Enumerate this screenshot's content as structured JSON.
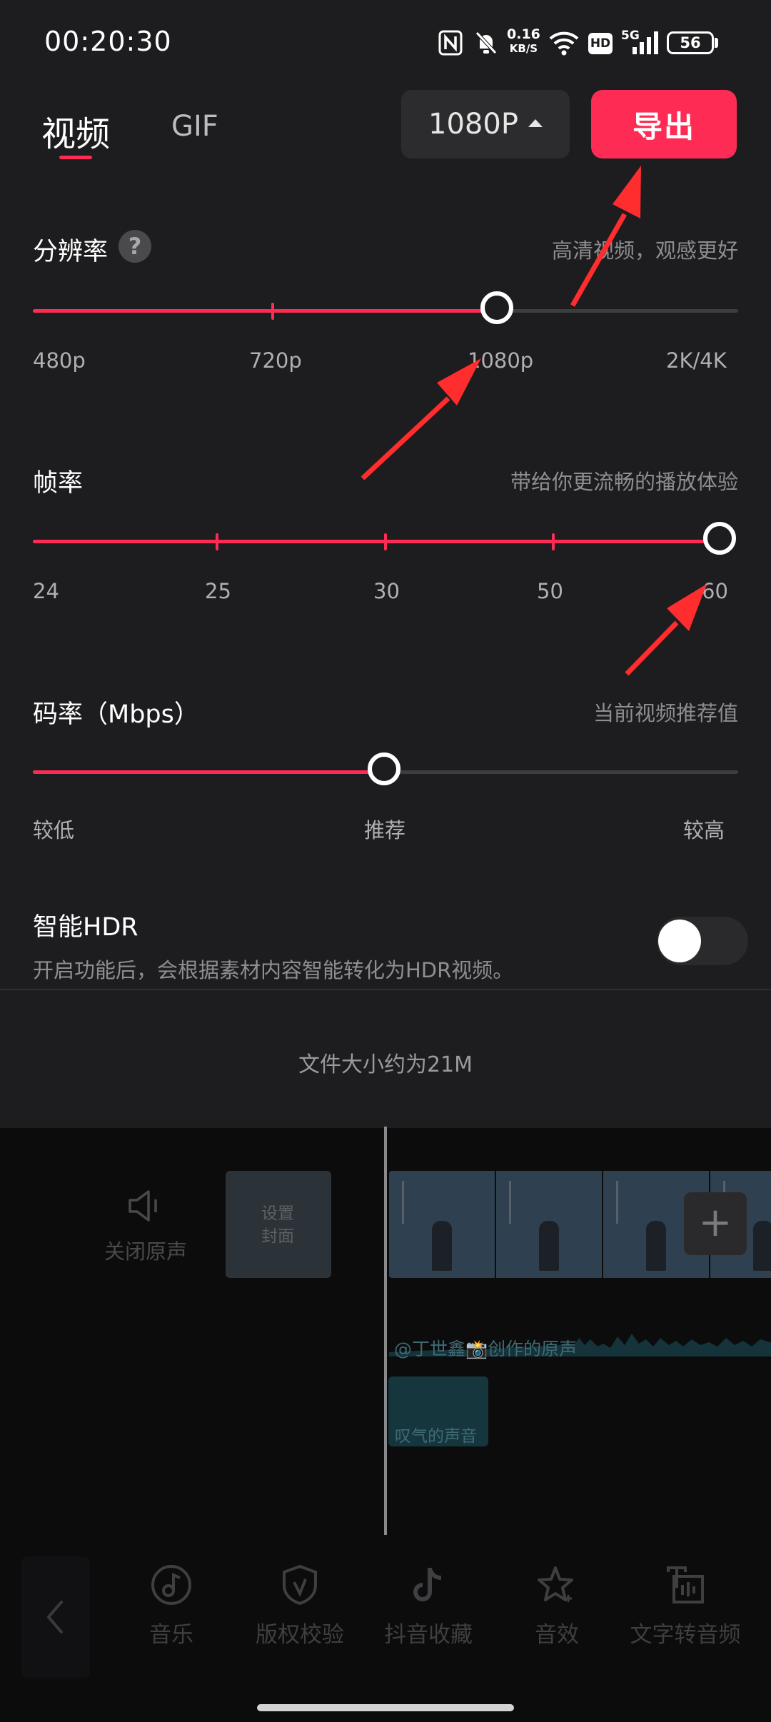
{
  "status_bar": {
    "time": "00:20:30",
    "net_speed_value": "0.16",
    "net_speed_unit": "KB/S",
    "hd_badge": "HD",
    "network_type": "5G",
    "battery": "56",
    "icons": [
      "nfc-icon",
      "mute-bell-icon",
      "wifi-icon",
      "hd-icon",
      "signal-5g-icon",
      "battery-icon"
    ]
  },
  "header": {
    "tabs": [
      {
        "label": "视频",
        "active": true
      },
      {
        "label": "GIF",
        "active": false
      }
    ],
    "resolution_select": "1080P",
    "export_label": "导出"
  },
  "resolution": {
    "title": "分辨率",
    "hint": "高清视频，观感更好",
    "help_glyph": "?",
    "labels": [
      "480p",
      "720p",
      "1080p",
      "2K/4K"
    ],
    "selected": "1080p"
  },
  "frame_rate": {
    "title": "帧率",
    "hint": "带给你更流畅的播放体验",
    "labels": [
      "24",
      "25",
      "30",
      "50",
      "60"
    ],
    "selected": "60"
  },
  "bitrate": {
    "title": "码率（Mbps）",
    "hint": "当前视频推荐值",
    "labels": [
      "较低",
      "推荐",
      "较高"
    ],
    "selected": "推荐"
  },
  "hdr": {
    "title": "智能HDR",
    "description": "开启功能后，会根据素材内容智能转化为HDR视频。",
    "enabled": false
  },
  "file_size_text": "文件大小约为21M",
  "editor": {
    "mute_label": "关闭原声",
    "cover_label_line1": "设置",
    "cover_label_line2": "封面",
    "add_glyph": "+",
    "audio_track_1": "@丁世鑫📸创作的原声",
    "audio_track_2": "叹气的声音"
  },
  "toolbar": {
    "items": [
      {
        "label": "音乐",
        "icon": "music-note-icon"
      },
      {
        "label": "版权校验",
        "icon": "shield-check-icon"
      },
      {
        "label": "抖音收藏",
        "icon": "tiktok-icon"
      },
      {
        "label": "音效",
        "icon": "star-sparkle-icon"
      },
      {
        "label": "文字转音频",
        "icon": "text-to-audio-icon"
      }
    ]
  },
  "colors": {
    "accent": "#fe2c55",
    "panel_bg": "#1d1d1f",
    "arrow": "#ff2d2d"
  }
}
